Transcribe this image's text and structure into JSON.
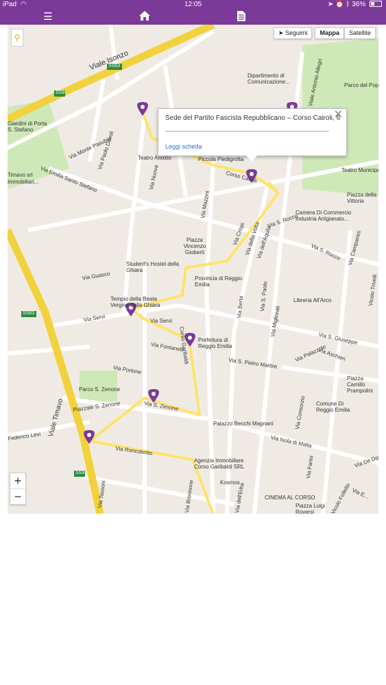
{
  "status_bar": {
    "device": "iPad",
    "time": "12:05",
    "battery": "36%"
  },
  "nav": {
    "icons": [
      "hamburger-menu-icon",
      "home-icon",
      "document-icon"
    ]
  },
  "map": {
    "type_buttons": {
      "follow": "Seguimi",
      "map": "Mappa",
      "satellite": "Satellite"
    },
    "zoom": {
      "in": "+",
      "out": "−"
    },
    "route_color": "#ffe36b",
    "marker_color": "#7b3a98",
    "labels": {
      "viale_isonzo": "Viale Isonzo",
      "ss63a": "SS63",
      "ss9a": "SS9",
      "dipartimento": "Dipartimento di Comunicazione...",
      "via_antonio_allegri": "Viale Antonio Allegri",
      "parco_popolo": "Parco del Popolo",
      "giardini": "Giardini di Porta S. Stefano",
      "via_monte_pasubio": "Via Monte Pasubio",
      "via_paolo_davoli": "Via Paolo Davoli",
      "timavo_srl": "Timavo srl",
      "timavo_immobiliari": "Immobiliari...",
      "teatro_ariosto": "Teatro Ariosto",
      "piccola_piedigrotta": "Piccola Piedigrotta",
      "corso_cairoli": "Corso Cairoli",
      "teatro_municipale": "Teatro Municipale",
      "via_nuova": "Via Nuova",
      "via_emilia_santo_stefano": "Via Emilia Santo Stefano",
      "piazza_vittoria": "Piazza della Vittoria",
      "camera_commercio": "Camera Di Commercio Industria Artigianato...",
      "via_mazzini": "Via Mazzini",
      "via_crispi": "Via Crispi",
      "via_s_rocco": "Via S. Rocco",
      "via_aquila": "Via dell'Aquila",
      "via_della_volta": "Via della Volta",
      "via_s_rocco_2": "Via S. Rocco",
      "piazza_gioberti": "Piazza Vincenzo Gioberti",
      "students_hostel": "Student's Hostel della Ghiara",
      "via_campanini": "Via Campanini",
      "via_guasco": "Via Guasco",
      "provincia": "Provincia di Reggio Emilia",
      "via_s_paolo": "Via S. Paolo",
      "via_berta": "Via Berta",
      "via_migliorati": "Via Migliorati",
      "libreria": "Libreria All'Arco",
      "vicolo_trivelli": "Vicolo Trivelli",
      "tempio": "Tempio della Beata Vergine della Ghiara",
      "ss63b": "SS63",
      "via_servi": "Via Servi",
      "via_servi_2": "Via Servi",
      "corso_garibaldi": "Corso Garibaldi",
      "via_s_giuseppe": "Via S. Giuseppe",
      "via_fontanelli": "Via Fontanelli",
      "prefettura": "Prefettura di Reggio Emilia",
      "via_aschieri": "Via Aschieri",
      "via_s_pietro_martire": "Via S. Pietro Martire",
      "via_palazzolo": "Via Palazzolo",
      "piazza_camillo": "Piazza Camillo Prampolini",
      "via_portone": "Via Portone",
      "viale_timavo": "Viale Timavo",
      "parco_zenone": "Parco S. Zenone",
      "piazzale_zenone": "Piazzale S. Zenone",
      "via_s_zenone": "Via S. Zenone",
      "via_consorzio": "Via Consorzio",
      "comune": "Comune Di Reggio Emilia",
      "federico_levi": "Federico Levi",
      "palazzo_becchi": "Palazzo Becchi Magnani",
      "via_isola_malta": "Via Isola di Malta",
      "via_roncobotto": "Via Roncobotto",
      "via_farini": "Via Farini",
      "agenzia": "Agenzia Immobiliare Corso Garibaldi SRL",
      "ss9b": "SS9",
      "via_tassoni": "Via Tassoni",
      "kosmos": "Kosmos",
      "via_brennone": "Via Brennone",
      "vicolo_folletto": "Vicolo Folletto",
      "via_erba": "Via dell'Erba",
      "cinema": "CINEMA AL CORSO",
      "piazza_luigi": "Piazza Luigi Roversi",
      "via_de_dottori": "Via Dè Dottori",
      "via_e": "Via E..."
    }
  },
  "popup": {
    "title": "Sede del Partito Fascista Repubblicano – Corso Cairoli, 6",
    "link": "Leggi scheda",
    "close": "✕"
  }
}
